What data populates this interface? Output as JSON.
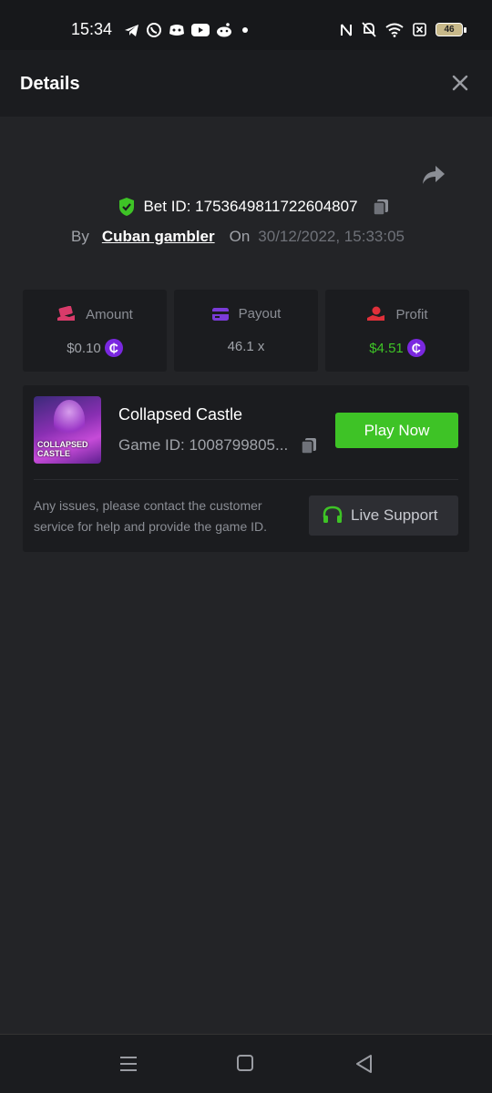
{
  "status_bar": {
    "time": "15:34",
    "battery": "46",
    "left_icons": [
      "telegram-icon",
      "whatsapp-icon",
      "discord-icon",
      "youtube-icon",
      "reddit-icon",
      "dot-icon"
    ],
    "right_icons": [
      "nfc-icon",
      "bell-off-icon",
      "wifi-icon",
      "sim-x-icon",
      "battery-icon"
    ]
  },
  "header": {
    "title": "Details"
  },
  "bet": {
    "id_text": "Bet ID: 1753649811722604807",
    "by_label": "By",
    "author": "Cuban gambler",
    "on_label": "On",
    "date": "30/12/2022, 15:33:05"
  },
  "stats": {
    "amount": {
      "label": "Amount",
      "value": "$0.10"
    },
    "payout": {
      "label": "Payout",
      "value": "46.1 x"
    },
    "profit": {
      "label": "Profit",
      "value": "$4.51"
    }
  },
  "coin_symbol": "₵",
  "game": {
    "thumb_text_line1": "COLLAPSED",
    "thumb_text_line2": "CASTLE",
    "title": "Collapsed Castle",
    "id_text": "Game ID: 1008799805...",
    "play_label": "Play Now",
    "support_text": "Any issues, please contact the customer service for help and provide the game ID.",
    "support_label": "Live Support"
  },
  "colors": {
    "accent_green": "#3ec326",
    "coin_purple": "#7a28e0",
    "background": "#232427",
    "card": "#1b1c1f"
  }
}
